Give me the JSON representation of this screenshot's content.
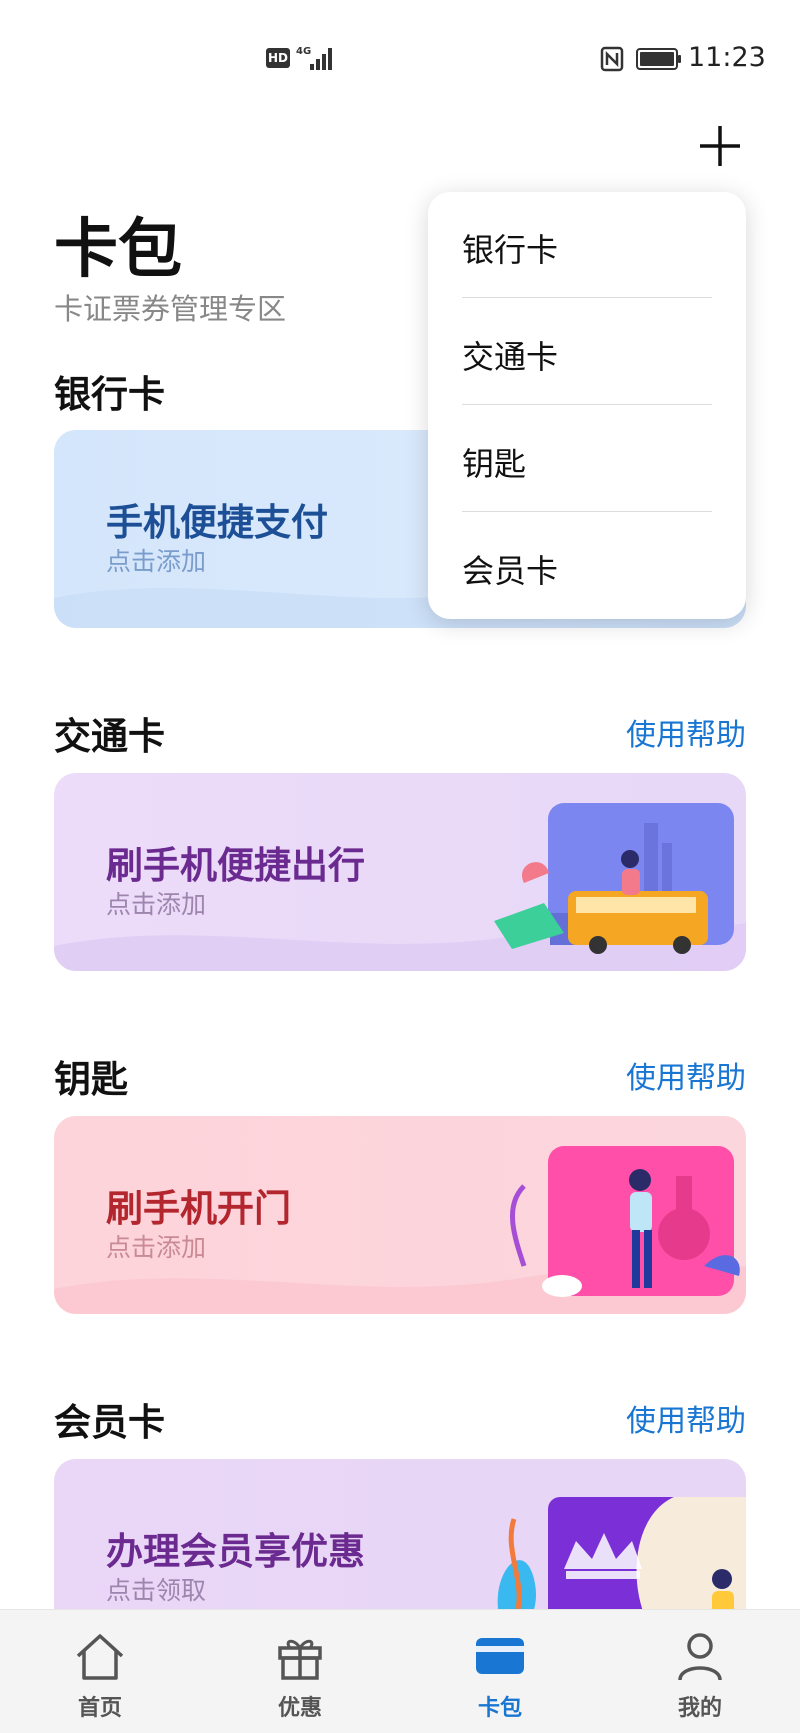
{
  "status_bar": {
    "hd": "HD",
    "network": "4G",
    "time": "11:23"
  },
  "header": {
    "title": "卡包",
    "subtitle": "卡证票券管理专区",
    "add_icon": "plus-icon"
  },
  "sections": {
    "bank": {
      "title": "银行卡",
      "card_title": "手机便捷支付",
      "card_sub": "点击添加"
    },
    "transit": {
      "title": "交通卡",
      "help": "使用帮助",
      "card_title": "刷手机便捷出行",
      "card_sub": "点击添加"
    },
    "key": {
      "title": "钥匙",
      "help": "使用帮助",
      "card_title": "刷手机开门",
      "card_sub": "点击添加"
    },
    "member": {
      "title": "会员卡",
      "help": "使用帮助",
      "card_title": "办理会员享优惠",
      "card_sub": "点击领取"
    }
  },
  "dropdown": {
    "items": [
      {
        "label": "银行卡"
      },
      {
        "label": "交通卡"
      },
      {
        "label": "钥匙"
      },
      {
        "label": "会员卡"
      }
    ]
  },
  "bottom_nav": {
    "items": [
      {
        "label": "首页",
        "icon": "home-icon"
      },
      {
        "label": "优惠",
        "icon": "gift-icon"
      },
      {
        "label": "卡包",
        "icon": "card-icon",
        "active": true
      },
      {
        "label": "我的",
        "icon": "person-icon"
      }
    ]
  },
  "colors": {
    "accent": "#1976d2",
    "bank_card": "#d4e6fb",
    "transit_card": "#ecdcf9",
    "key_card": "#fdd4da",
    "member_card": "#ead7f7"
  }
}
